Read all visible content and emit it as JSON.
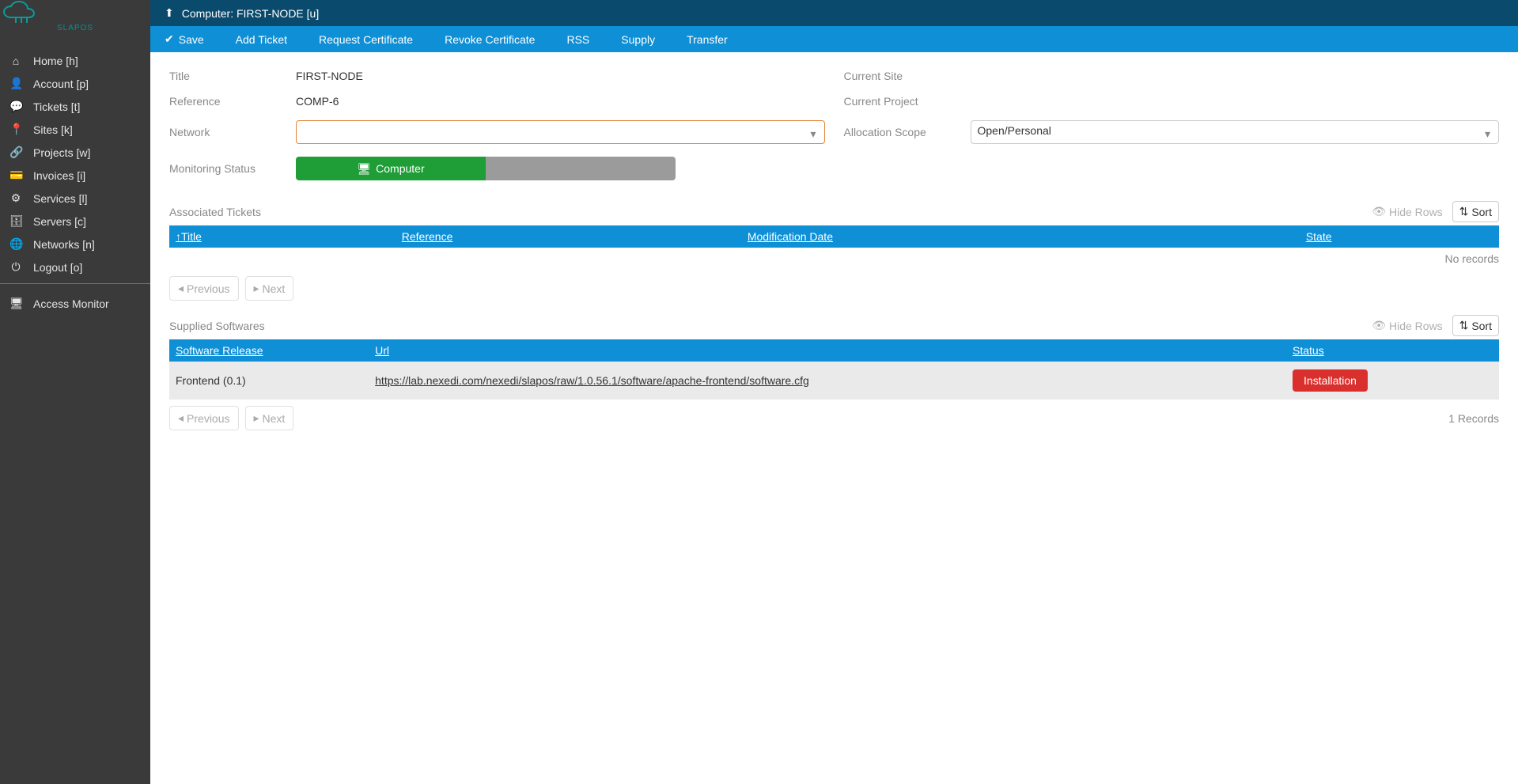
{
  "brand": "SLAPOS",
  "sidebar": {
    "items": [
      {
        "label": "Home [h]",
        "icon": "home"
      },
      {
        "label": "Account [p]",
        "icon": "user"
      },
      {
        "label": "Tickets [t]",
        "icon": "comments"
      },
      {
        "label": "Sites [k]",
        "icon": "marker"
      },
      {
        "label": "Projects [w]",
        "icon": "share"
      },
      {
        "label": "Invoices [i]",
        "icon": "card"
      },
      {
        "label": "Services [l]",
        "icon": "cogs"
      },
      {
        "label": "Servers [c]",
        "icon": "db"
      },
      {
        "label": "Networks [n]",
        "icon": "globe"
      },
      {
        "label": "Logout [o]",
        "icon": "power"
      }
    ],
    "monitor": {
      "label": "Access Monitor",
      "icon": "desktop"
    }
  },
  "breadcrumb": {
    "text": "Computer: FIRST-NODE [u]"
  },
  "tabs": {
    "save": "Save",
    "add_ticket": "Add Ticket",
    "request_cert": "Request Certificate",
    "revoke_cert": "Revoke Certificate",
    "rss": "RSS",
    "supply": "Supply",
    "transfer": "Transfer"
  },
  "form": {
    "title_label": "Title",
    "title_value": "FIRST-NODE",
    "reference_label": "Reference",
    "reference_value": "COMP-6",
    "network_label": "Network",
    "network_value": "",
    "monitoring_label": "Monitoring Status",
    "monitor_computer": "Computer",
    "site_label": "Current Site",
    "site_value": "",
    "project_label": "Current Project",
    "project_value": "",
    "alloc_label": "Allocation Scope",
    "alloc_value": "Open/Personal"
  },
  "tickets": {
    "title": "Associated Tickets",
    "hide": "Hide Rows",
    "sort": "Sort",
    "cols": {
      "title": "Title",
      "ref": "Reference",
      "mod": "Modification Date",
      "state": "State"
    },
    "no_records": "No records",
    "prev": "Previous",
    "next": "Next"
  },
  "softwares": {
    "title": "Supplied Softwares",
    "hide": "Hide Rows",
    "sort": "Sort",
    "cols": {
      "release": "Software Release",
      "url": "Url",
      "status": "Status"
    },
    "rows": [
      {
        "release": "Frontend (0.1)",
        "url": "https://lab.nexedi.com/nexedi/slapos/raw/1.0.56.1/software/apache-frontend/software.cfg",
        "status": "Installation"
      }
    ],
    "prev": "Previous",
    "next": "Next",
    "records": "1 Records"
  }
}
